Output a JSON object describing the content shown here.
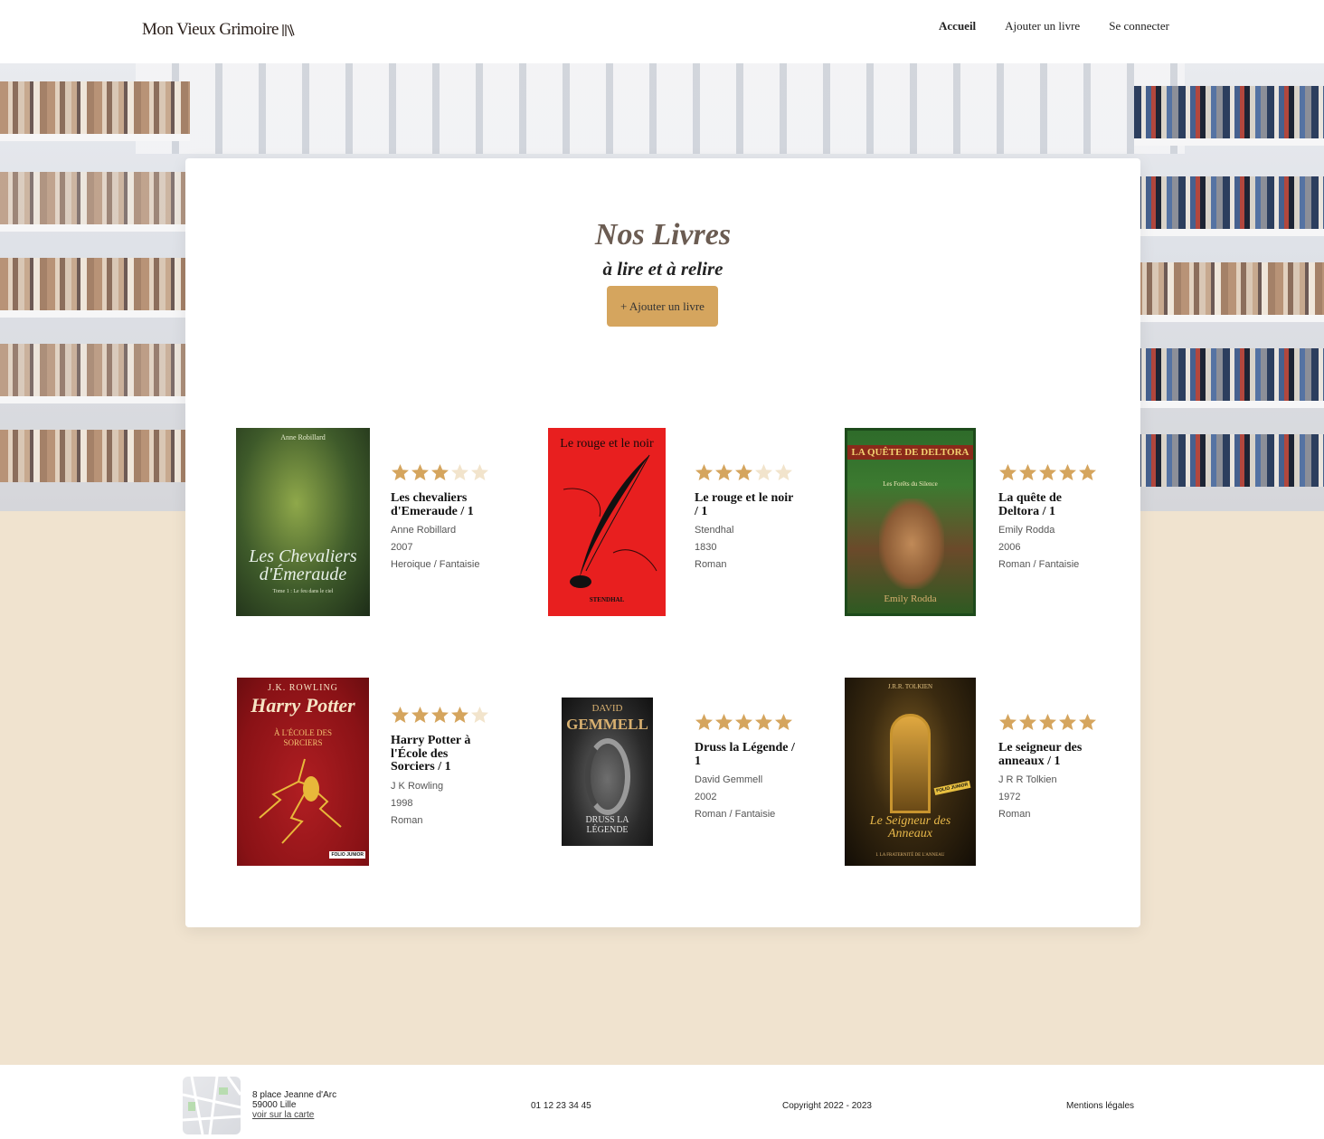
{
  "header": {
    "logo_text": "Mon Vieux Grimoire",
    "nav": [
      {
        "label": "Accueil",
        "active": true
      },
      {
        "label": "Ajouter un livre",
        "active": false
      },
      {
        "label": "Se connecter",
        "active": false
      }
    ]
  },
  "main": {
    "title": "Nos Livres",
    "subtitle": "à lire et à relire",
    "add_button": "+ Ajouter un livre",
    "accent_color": "#d5a55e"
  },
  "books": [
    {
      "title": "Les chevaliers d'Emeraude / 1",
      "author": "Anne Robillard",
      "year": "2007",
      "genre": "Heroique / Fantaisie",
      "rating": 3,
      "cover": {
        "top_text": "Anne Robillard",
        "main_text": "Les Chevaliers d'Émeraude",
        "sub_text": "Tome 1 : Le feu dans le ciel"
      }
    },
    {
      "title": "Le rouge et le noir / 1",
      "author": "Stendhal",
      "year": "1830",
      "genre": "Roman",
      "rating": 3,
      "cover": {
        "top_text": "Le rouge et le noir",
        "main_text": "STENDHAL"
      }
    },
    {
      "title": "La quête de Deltora / 1",
      "author": "Emily Rodda",
      "year": "2006",
      "genre": "Roman / Fantaisie",
      "rating": 5,
      "cover": {
        "top_text": "LA QUÊTE DE DELTORA",
        "main_text": "Les Forêts du Silence",
        "sub_text": "Emily Rodda"
      }
    },
    {
      "title": "Harry Potter à l'École des Sorciers / 1",
      "author": "J K Rowling",
      "year": "1998",
      "genre": "Roman",
      "rating": 4,
      "cover": {
        "top_text": "J.K. ROWLING",
        "main_text": "Harry Potter",
        "sub_text": "À L'ÉCOLE DES SORCIERS",
        "badge": "FOLIO JUNIOR"
      }
    },
    {
      "title": "Druss la Légende / 1",
      "author": "David Gemmell",
      "year": "2002",
      "genre": "Roman / Fantaisie",
      "rating": 5,
      "cover": {
        "top_text": "DAVID",
        "main_text": "GEMMELL",
        "sub_text": "DRUSS LA LÉGENDE"
      }
    },
    {
      "title": "Le seigneur des anneaux / 1",
      "author": "J R R Tolkien",
      "year": "1972",
      "genre": "Roman",
      "rating": 5,
      "cover": {
        "top_text": "J.R.R. TOLKIEN",
        "main_text": "Le Seigneur des Anneaux",
        "sub_text": "I. LA FRATERNITÉ DE L'ANNEAU",
        "badge": "FOLIO JUNIOR"
      }
    }
  ],
  "footer": {
    "address_line1": "8 place Jeanne d'Arc",
    "address_line2": "59000 Lille",
    "map_link": "voir sur la carte",
    "phone": "01 12 23 34 45",
    "copyright": "Copyright 2022 - 2023",
    "legal": "Mentions légales"
  }
}
